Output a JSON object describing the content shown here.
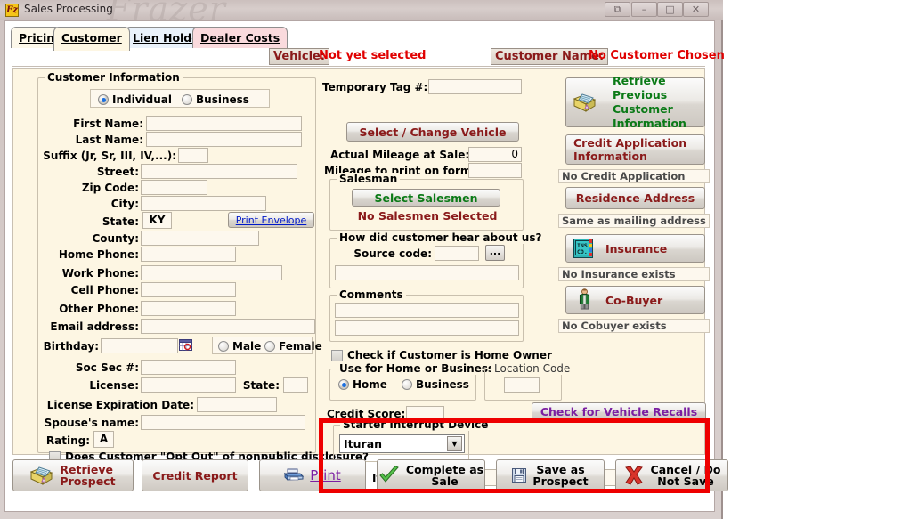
{
  "window": {
    "title": "Sales Processing",
    "app_icon_text": "Fz",
    "watermark": "Frazer",
    "controls": [
      {
        "name": "restore-window-button",
        "glyph": "⧉"
      },
      {
        "name": "minimize-window-button",
        "glyph": "–"
      },
      {
        "name": "maximize-window-button",
        "glyph": "□"
      },
      {
        "name": "close-window-button",
        "glyph": "✕"
      }
    ]
  },
  "tabs": [
    {
      "label": "Pricing",
      "accel": "P"
    },
    {
      "label": "Customer",
      "accel": "C"
    },
    {
      "label": "Lien Holder",
      "accel": "L"
    },
    {
      "label": "Dealer Costs",
      "accel": "D"
    }
  ],
  "header": {
    "vehicle_label": "Vehicle:",
    "vehicle_value": "Not yet selected",
    "customer_name_label": "Customer Name:",
    "customer_name_value": "No Customer Chosen"
  },
  "customer_information": {
    "group_title": "Customer Information",
    "type_individual": "Individual",
    "type_business": "Business",
    "type_selected": "Individual",
    "fields": [
      {
        "label": "First Name:",
        "value": ""
      },
      {
        "label": "Last Name:",
        "value": ""
      },
      {
        "label": "Suffix (Jr, Sr, III, IV,...):",
        "value": ""
      },
      {
        "label": "Street:",
        "value": ""
      },
      {
        "label": "Zip Code:",
        "value": ""
      },
      {
        "label": "City:",
        "value": ""
      },
      {
        "label": "State:",
        "value": "KY"
      },
      {
        "label": "County:",
        "value": ""
      },
      {
        "label": "Home Phone:",
        "value": ""
      },
      {
        "label": "Work Phone:",
        "value": ""
      },
      {
        "label": "Cell Phone:",
        "value": ""
      },
      {
        "label": "Other Phone:",
        "value": ""
      },
      {
        "label": "Email address:",
        "value": ""
      },
      {
        "label": "Birthday:",
        "value": ""
      },
      {
        "label": "Soc Sec #:",
        "value": ""
      },
      {
        "label": "License:",
        "value": ""
      },
      {
        "label": "State:",
        "value": ""
      },
      {
        "label": "License Expiration Date:",
        "value": ""
      },
      {
        "label": "Spouse's name:",
        "value": ""
      },
      {
        "label": "Rating:",
        "value": "A"
      }
    ],
    "print_envelope_label": "Print Envelope",
    "gender_male": "Male",
    "gender_female": "Female",
    "gender_selected": "",
    "opt_out_label": "Does Customer \"Opt Out\" of nonpublic disclosure?",
    "opt_out_checked": false
  },
  "middle": {
    "temporary_tag_label": "Temporary Tag #:",
    "temporary_tag_value": "",
    "select_change_vehicle": "Select / Change Vehicle",
    "actual_mileage_label": "Actual Mileage at Sale:",
    "actual_mileage_value": "0",
    "mileage_forms_label": "Mileage to print on forms:",
    "mileage_forms_value": "",
    "salesman_group": "Salesman",
    "select_salesmen_button": "Select Salesmen",
    "salesman_status": "No Salesmen Selected",
    "hear_about_group": "How did customer hear about us?",
    "source_code_label": "Source code:",
    "source_code_value": "",
    "source_code_desc": "",
    "comments_group": "Comments",
    "comment_line_1": "",
    "comment_line_2": "",
    "home_owner_label": "Check if Customer is Home Owner",
    "home_owner_checked": false,
    "use_for_group": "Use for Home or Business?",
    "use_home": "Home",
    "use_business": "Business",
    "use_selected": "Home",
    "location_code_group": "Location Code",
    "location_code_value": "",
    "credit_score_label": "Credit Score:",
    "credit_score_value": "",
    "check_recalls_button": "Check for Vehicle Recalls",
    "starter_group": "Starter Interrupt Device",
    "starter_value": "Ituran",
    "starter_options": [
      "Ituran"
    ],
    "device_ip_label": "Ituran Device IP:",
    "device_ip_value": ""
  },
  "right_panel": {
    "retrieve_previous": "Retrieve Previous Customer Information",
    "credit_application": "Credit Application Information",
    "credit_application_status": "No Credit Application",
    "residence_address": "Residence Address",
    "residence_status": "Same as mailing address",
    "insurance": "Insurance",
    "insurance_status": "No Insurance exists",
    "insurance_icon_text_1": "INS",
    "insurance_icon_text_2": "CO.",
    "cobuyer": "Co-Buyer",
    "cobuyer_status": "No Cobuyer exists"
  },
  "bottom_buttons": [
    {
      "name": "retrieve-prospect-button",
      "line1": "Retrieve",
      "line2": "Prospect",
      "icon": "folder-icon"
    },
    {
      "name": "credit-report-button",
      "line1": "Credit Report",
      "line2": "",
      "icon": ""
    },
    {
      "name": "print-button",
      "line1": "Print",
      "line2": "",
      "icon": "printer-icon"
    },
    {
      "name": "complete-as-sale-button",
      "line1": "Complete as",
      "line2": "Sale",
      "icon": "check-icon"
    },
    {
      "name": "save-as-prospect-button",
      "line1": "Save as",
      "line2": "Prospect",
      "icon": "disk-icon"
    },
    {
      "name": "cancel-do-not-save-button",
      "line1": "Cancel / Do",
      "line2": "Not Save",
      "icon": "x-icon"
    }
  ],
  "colors": {
    "red_highlight": "#ee0000",
    "alert_red": "#e00000",
    "dark_red": "#8a1a1a",
    "green": "#0b7a17",
    "purple": "#7b1fa2",
    "panel_bg": "#fdf6e3"
  }
}
